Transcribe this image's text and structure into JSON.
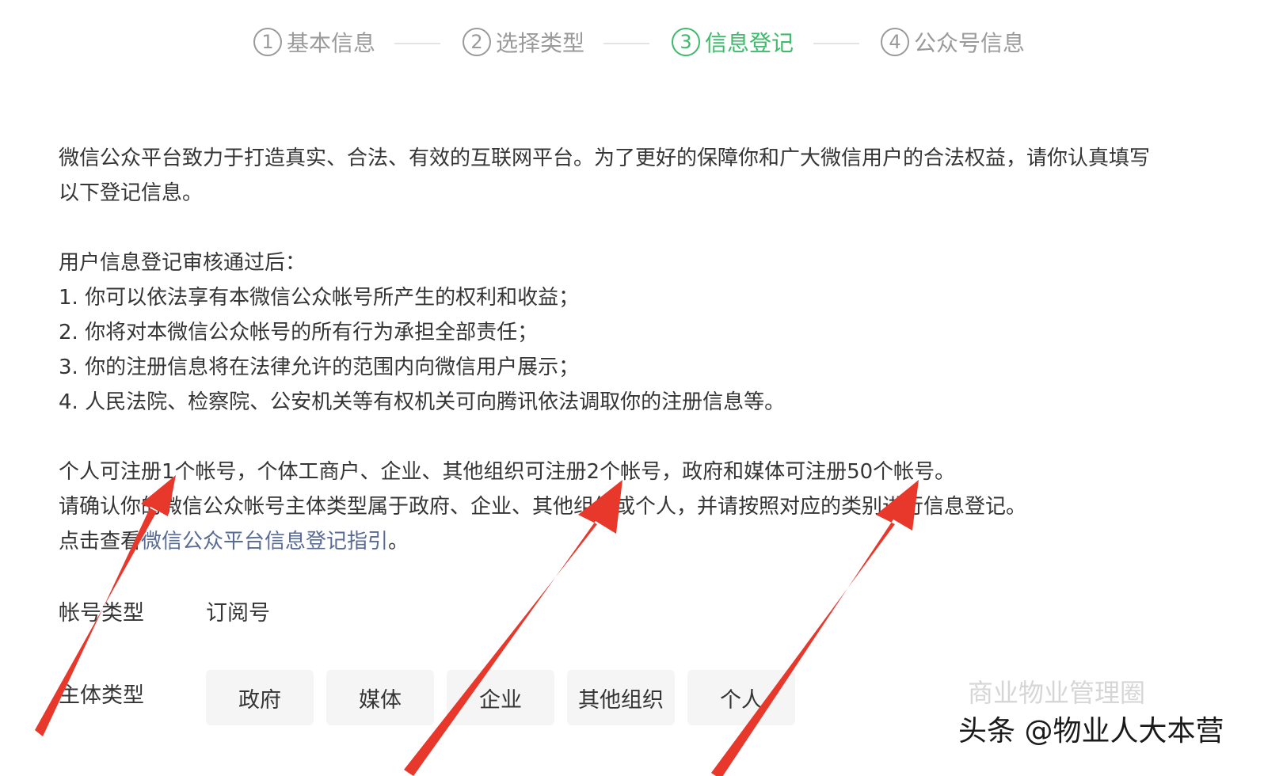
{
  "steps": [
    {
      "num": "1",
      "label": "基本信息",
      "active": false
    },
    {
      "num": "2",
      "label": "选择类型",
      "active": false
    },
    {
      "num": "3",
      "label": "信息登记",
      "active": true
    },
    {
      "num": "4",
      "label": "公众号信息",
      "active": false
    }
  ],
  "intro": {
    "line1": "微信公众平台致力于打造真实、合法、有效的互联网平台。为了更好的保障你和广大微信用户的合法权益，请你认真填写",
    "line2": "以下登记信息。"
  },
  "after_review": {
    "heading": "用户信息登记审核通过后：",
    "items": [
      "1. 你可以依法享有本微信公众帐号所产生的权利和收益；",
      "2. 你将对本微信公众帐号的所有行为承担全部责任；",
      "3. 你的注册信息将在法律允许的范围内向微信用户展示；",
      "4. 人民法院、检察院、公安机关等有权机关可向腾讯依法调取你的注册信息等。"
    ]
  },
  "limits": {
    "line1": "个人可注册1个帐号，个体工商户、企业、其他组织可注册2个帐号，政府和媒体可注册50个帐号。",
    "line2": "请确认你的微信公众帐号主体类型属于政府、企业、其他组织或个人，并请按照对应的类别进行信息登记。",
    "line3_prefix": "点击查看",
    "line3_link": "微信公众平台信息登记指引",
    "line3_suffix": "。"
  },
  "account_type": {
    "label": "帐号类型",
    "value": "订阅号"
  },
  "subject_type": {
    "label": "主体类型",
    "options": [
      "政府",
      "媒体",
      "企业",
      "其他组织",
      "个人"
    ]
  },
  "watermark": {
    "line1": "商业物业管理圈",
    "line2": "头条 @物业人大本营"
  },
  "colors": {
    "active_step": "#3dba6a",
    "inactive_step": "#9a9a9a",
    "link": "#576b95",
    "arrow": "#e8372b"
  }
}
